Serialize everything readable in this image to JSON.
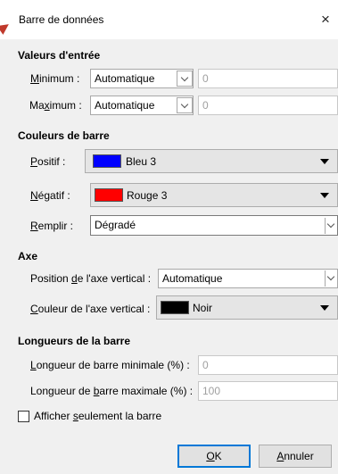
{
  "dialog": {
    "title": "Barre de données",
    "close_symbol": "×"
  },
  "input_values": {
    "section_title": "Valeurs d'entrée",
    "minimum": {
      "label_prefix": "",
      "label_underlined": "M",
      "label_suffix": "inimum :",
      "mode": "Automatique",
      "value": "0"
    },
    "maximum": {
      "label_prefix": "Ma",
      "label_underlined": "x",
      "label_suffix": "imum :",
      "mode": "Automatique",
      "value": "0"
    }
  },
  "bar_colors": {
    "section_title": "Couleurs de barre",
    "positive": {
      "label_underlined": "P",
      "label_suffix": "ositif :",
      "color_name": "Bleu 3",
      "color": "#0000ff"
    },
    "negative": {
      "label_underlined": "N",
      "label_suffix": "égatif :",
      "color_name": "Rouge 3",
      "color": "#ff0000"
    },
    "fill": {
      "label_underlined": "R",
      "label_suffix": "emplir :",
      "value": "Dégradé"
    }
  },
  "axis": {
    "section_title": "Axe",
    "position": {
      "label_prefix": "Position ",
      "label_underlined": "d",
      "label_suffix": "e l'axe vertical :",
      "value": "Automatique"
    },
    "color": {
      "label_underlined": "C",
      "label_suffix": "ouleur de l'axe vertical :",
      "color_name": "Noir",
      "color": "#000000"
    }
  },
  "bar_lengths": {
    "section_title": "Longueurs de la barre",
    "min": {
      "label_underlined": "L",
      "label_suffix": "ongueur de barre minimale (%) :",
      "value": "0"
    },
    "max": {
      "label_prefix": "Longueur de ",
      "label_underlined": "b",
      "label_suffix": "arre maximale (%) :",
      "value": "100"
    }
  },
  "only_bar": {
    "label_prefix": "Afficher ",
    "label_underlined": "s",
    "label_suffix": "eulement la barre",
    "checked": false
  },
  "buttons": {
    "ok": {
      "label_underlined": "O",
      "label_suffix": "K"
    },
    "cancel": {
      "label_underlined": "A",
      "label_suffix": "nnuler"
    }
  }
}
